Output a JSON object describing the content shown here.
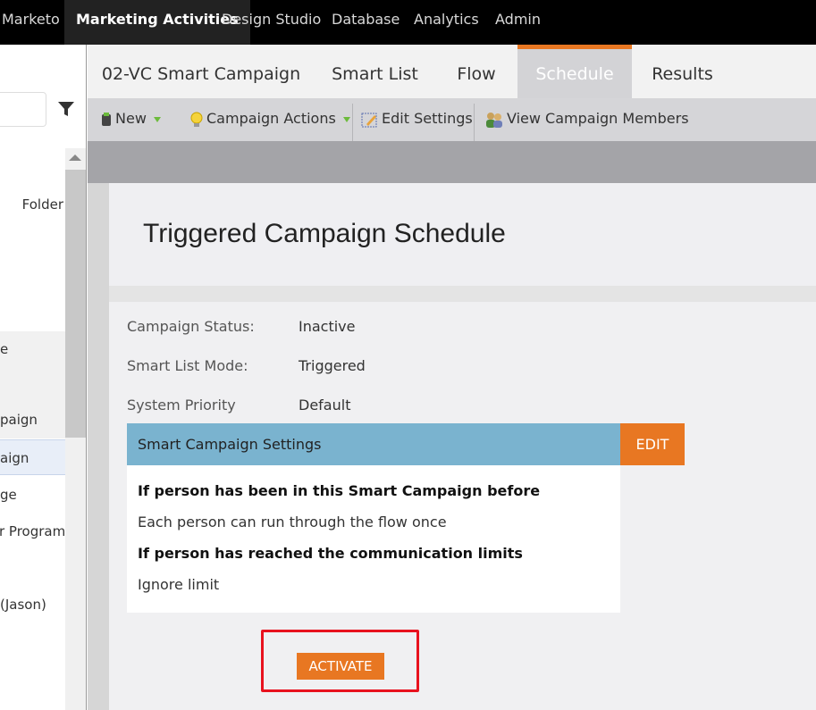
{
  "topnav": {
    "items": [
      {
        "label": "Marketo"
      },
      {
        "label": "Marketing Activities"
      },
      {
        "label": "Design Studio"
      },
      {
        "label": "Database"
      },
      {
        "label": "Analytics"
      },
      {
        "label": "Admin"
      }
    ],
    "active": "Marketing Activities"
  },
  "sidebar": {
    "items": [
      {
        "label": "Folder"
      },
      {
        "label": "e"
      },
      {
        "label": "paign"
      },
      {
        "label": "aign"
      },
      {
        "label": "ge"
      },
      {
        "label": "r Program"
      },
      {
        "label": "(Jason)"
      }
    ]
  },
  "tabs": [
    {
      "label": "02-VC Smart Campaign"
    },
    {
      "label": "Smart List"
    },
    {
      "label": "Flow"
    },
    {
      "label": "Schedule"
    },
    {
      "label": "Results"
    }
  ],
  "active_tab": "Schedule",
  "toolbar": {
    "new_label": "New",
    "campaign_actions_label": "Campaign Actions",
    "edit_settings_label": "Edit Settings",
    "view_members_label": "View Campaign Members"
  },
  "page": {
    "title": "Triggered Campaign Schedule"
  },
  "fields": {
    "campaign_status_label": "Campaign Status:",
    "campaign_status_value": "Inactive",
    "smart_list_mode_label": "Smart List Mode:",
    "smart_list_mode_value": "Triggered",
    "system_priority_label": "System Priority",
    "system_priority_value": "Default"
  },
  "settings": {
    "header": "Smart Campaign Settings",
    "edit_label": "EDIT",
    "rules": [
      {
        "heading": "If person has been in this Smart Campaign before",
        "value": "Each person can run through the flow once"
      },
      {
        "heading": "If person has reached the communication limits",
        "value": "Ignore limit"
      }
    ]
  },
  "activate_label": "ACTIVATE",
  "colors": {
    "accent_orange": "#e87722",
    "settings_header_blue": "#7ab3cf",
    "highlight_red": "#e8121e"
  }
}
